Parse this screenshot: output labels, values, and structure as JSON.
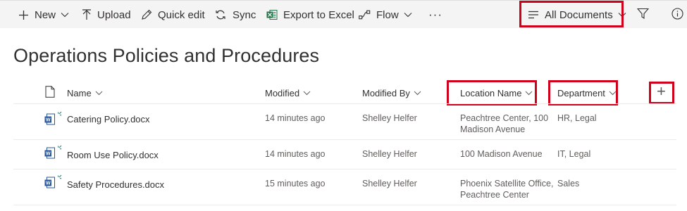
{
  "toolbar": {
    "new_label": "New",
    "upload_label": "Upload",
    "quick_edit_label": "Quick edit",
    "sync_label": "Sync",
    "export_label": "Export to Excel",
    "flow_label": "Flow",
    "more_label": "···",
    "view_label": "All Documents"
  },
  "page": {
    "title": "Operations Policies and Procedures"
  },
  "columns": {
    "name": "Name",
    "modified": "Modified",
    "modified_by": "Modified By",
    "location": "Location Name",
    "department": "Department",
    "add": "+"
  },
  "rows": [
    {
      "name": "Catering Policy.docx",
      "modified": "14 minutes ago",
      "modified_by": "Shelley Helfer",
      "location_line1": "Peachtree Center, 100",
      "location_line2": "Madison Avenue",
      "department": "HR, Legal"
    },
    {
      "name": "Room Use Policy.docx",
      "modified": "14 minutes ago",
      "modified_by": "Shelley Helfer",
      "location_line1": "100 Madison Avenue",
      "location_line2": "",
      "department": "IT, Legal"
    },
    {
      "name": "Safety Procedures.docx",
      "modified": "15 minutes ago",
      "modified_by": "Shelley Helfer",
      "location_line1": "Phoenix Satellite Office,",
      "location_line2": "Peachtree Center",
      "department": "Sales"
    }
  ],
  "colors": {
    "highlight": "#d0021b",
    "word_blue": "#2b579a",
    "excel_green": "#217346",
    "new_badge": "#2b8a8a"
  }
}
